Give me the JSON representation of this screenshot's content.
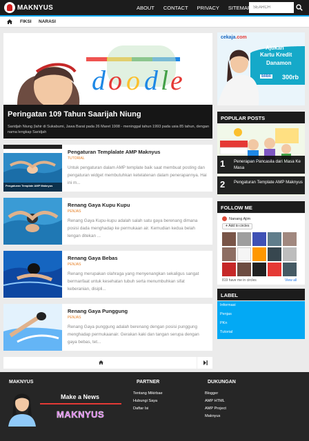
{
  "site": {
    "name": "MAKNYUS"
  },
  "topnav": [
    "ABOUT",
    "CONTACT",
    "PRIVACY",
    "SITEMAP"
  ],
  "search": {
    "placeholder": "SEARCH"
  },
  "categories": [
    "FIKSI",
    "NARASI"
  ],
  "hero": {
    "title": "Peringatan 109 Tahun Saarijah Niung",
    "desc": "Saridjah Niung (lahir di Sukabumi, Jawa Barat pada 26 Maret 1908 - meninggal tahun 1993 pada usia 85 tahun, dengan nama lengkap Saridjah",
    "doodle_text": "doodle"
  },
  "posts": [
    {
      "title": "Pengaturan Templalate AMP Maknyus",
      "label": "TUTORIAL",
      "excerpt": "Untuk pengaturan dalam AMP template baik saat membuat posting dan pengaturan widget membutuhkan ketelatenan dalam penerapannya. Hai ini m...",
      "thumb_caption": "Pengaturan Template AMP Maknyus"
    },
    {
      "title": "Renang Gaya Kupu Kupu",
      "label": "PENJAS",
      "excerpt": "Renang Gaya Kupu-kupu adalah salah satu gaya berenang dimana posisi dada menghadap ke permukaan air. Kemudian kedua belah lengan ditekan ..."
    },
    {
      "title": "Renang Gaya Bebas",
      "label": "PENJAS",
      "excerpt": "Renang merupakan olahraga yang menyenangkan sekaligus sangat bermanfaat untuk kesehatan tubuh serta menumbuhkan sifat keberanian, disipli..."
    },
    {
      "title": "Renang Gaya Punggung",
      "label": "PENJAS",
      "excerpt": "Renang Gaya punggung adalah berenang dengan posisi punggung menghadap permukaanair. Gerakan kaki dan tangan serupa dengan gaya bebas, tet..."
    }
  ],
  "ad": {
    "brand": "cekaja",
    "brand_suffix": ".com",
    "line1": "Ajukan",
    "line2": "Kartu Kredit",
    "line3": "Danamon",
    "price": "300rb",
    "store": "blibli"
  },
  "popular": {
    "heading": "POPULAR POSTS",
    "items": [
      {
        "num": "1",
        "title": "Penerapan Pancasila dari Masa Ke Masa"
      },
      {
        "num": "2",
        "title": "Pengaturan Template AMP Maknyus"
      }
    ]
  },
  "follow": {
    "heading": "FOLLOW ME",
    "name": "Nanang Ajim",
    "add_label": "Add to circles",
    "count_text": "819 have me in circles",
    "view_all": "View all"
  },
  "labels": {
    "heading": "LABEL",
    "items": [
      "Informasi",
      "Penjas",
      "PKn",
      "Tutorial"
    ]
  },
  "footer": {
    "brand_heading": "MAKNYUS",
    "banner_line": "Make a News",
    "banner_brand": "MAKNYUS",
    "partner_heading": "PARTNER",
    "partner_links": [
      "Tentang Mikirbae",
      "Hubungi Saya",
      "Daftar Isi"
    ],
    "support_heading": "DUKUNGAN",
    "support_links": [
      "Blogger",
      "AMP HTML",
      "AMP Project",
      "Maknyus"
    ]
  },
  "colors": {
    "accent": "#03a9f4",
    "dark": "#1c1c1c",
    "label_orange": "#e67e22"
  }
}
